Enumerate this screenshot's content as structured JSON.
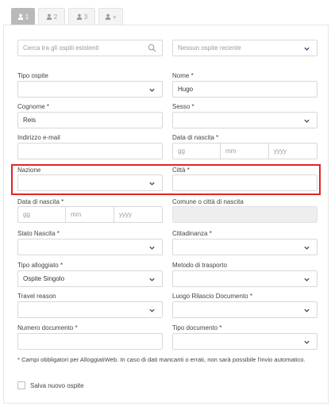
{
  "tabs": [
    {
      "num": "1",
      "active": true
    },
    {
      "num": "2",
      "active": false
    },
    {
      "num": "3",
      "active": false
    },
    {
      "num": "+",
      "active": false
    }
  ],
  "search": {
    "placeholder": "Cerca tra gli ospiti esistenti"
  },
  "recent": {
    "placeholder": "Nessun ospite recente"
  },
  "fields": {
    "tipo_ospite": {
      "label": "Tipo ospite",
      "value": ""
    },
    "nome": {
      "label": "Nome *",
      "value": "Hugo"
    },
    "cognome": {
      "label": "Cognome *",
      "value": "Reis"
    },
    "sesso": {
      "label": "Sesso *",
      "value": ""
    },
    "email": {
      "label": "Indirizzo e-mail",
      "value": ""
    },
    "data_nascita_1": {
      "label": "Data di nascita *"
    },
    "nazione": {
      "label": "Nazione",
      "value": ""
    },
    "citta": {
      "label": "Città *",
      "value": ""
    },
    "data_nascita_2": {
      "label": "Data di nascita *"
    },
    "comune": {
      "label": "Comune o città di nascita",
      "value": ""
    },
    "stato_nascita": {
      "label": "Stato Nascita *",
      "value": ""
    },
    "cittadinanza": {
      "label": "Cittadinanza *",
      "value": ""
    },
    "tipo_alloggiato": {
      "label": "Tipo alloggiato *",
      "value": "Ospite Singolo"
    },
    "metodo_trasporto": {
      "label": "Metodo di trasporto",
      "value": ""
    },
    "travel_reason": {
      "label": "Travel reason",
      "value": ""
    },
    "luogo_rilascio": {
      "label": "Luogo Rilascio Documento *",
      "value": ""
    },
    "numero_documento": {
      "label": "Numero documento *",
      "value": ""
    },
    "tipo_documento": {
      "label": "Tipo documento *",
      "value": ""
    }
  },
  "date_placeholders": {
    "day": "gg",
    "month": "mm",
    "year": "yyyy"
  },
  "note": "* Campi obbligatori per AlloggiatiWeb. In caso di dati mancanti o errati, non sarà possibile l'invio automatico.",
  "save_checkbox": {
    "label": "Salva nuovo ospite",
    "checked": false
  },
  "colors": {
    "highlight": "#e02424",
    "active_tab": "#b9b9b9"
  }
}
